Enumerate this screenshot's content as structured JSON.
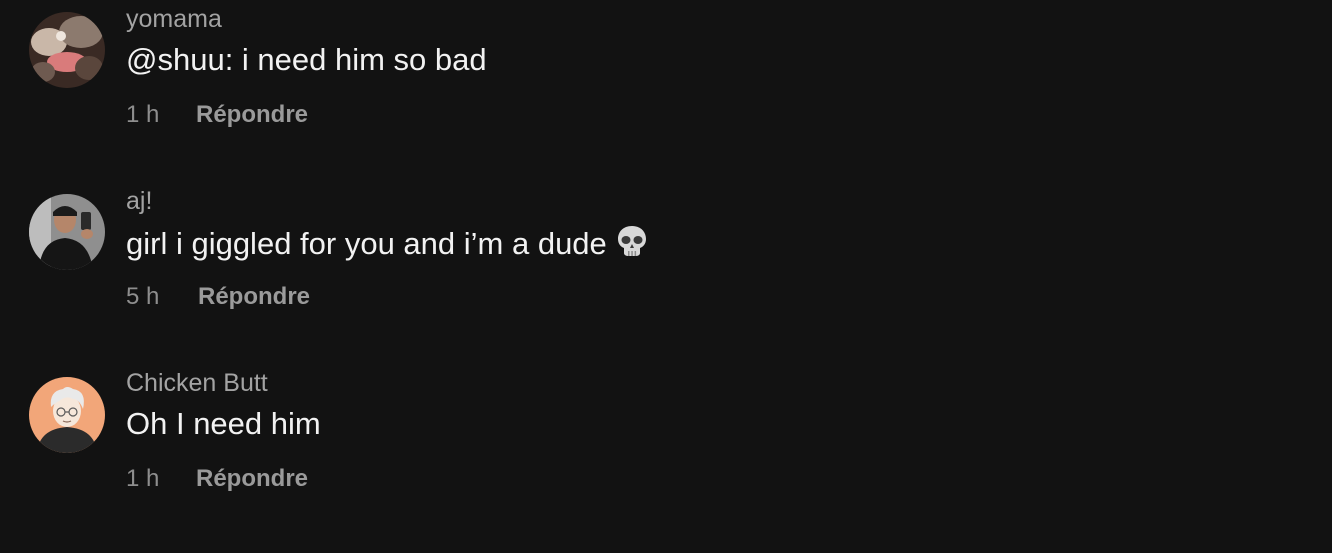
{
  "comments": [
    {
      "username": "yomama",
      "text": "@shuu: i need him so bad",
      "time": "1 h",
      "reply_label": "Répondre",
      "avatar_icon": "avatar-photo"
    },
    {
      "username": "aj!",
      "text": "girl i giggled for you and i’m a dude",
      "emoji": "skull-emoji-icon",
      "time": "5 h",
      "reply_label": "Répondre",
      "avatar_icon": "avatar-photo"
    },
    {
      "username": "Chicken Butt",
      "text": "Oh I need him",
      "time": "1 h",
      "reply_label": "Répondre",
      "avatar_icon": "avatar-illustration"
    }
  ],
  "colors": {
    "background": "#121212",
    "username": "#a3a3a3",
    "text": "#f2f2f2",
    "meta": "#8e8e8e"
  }
}
